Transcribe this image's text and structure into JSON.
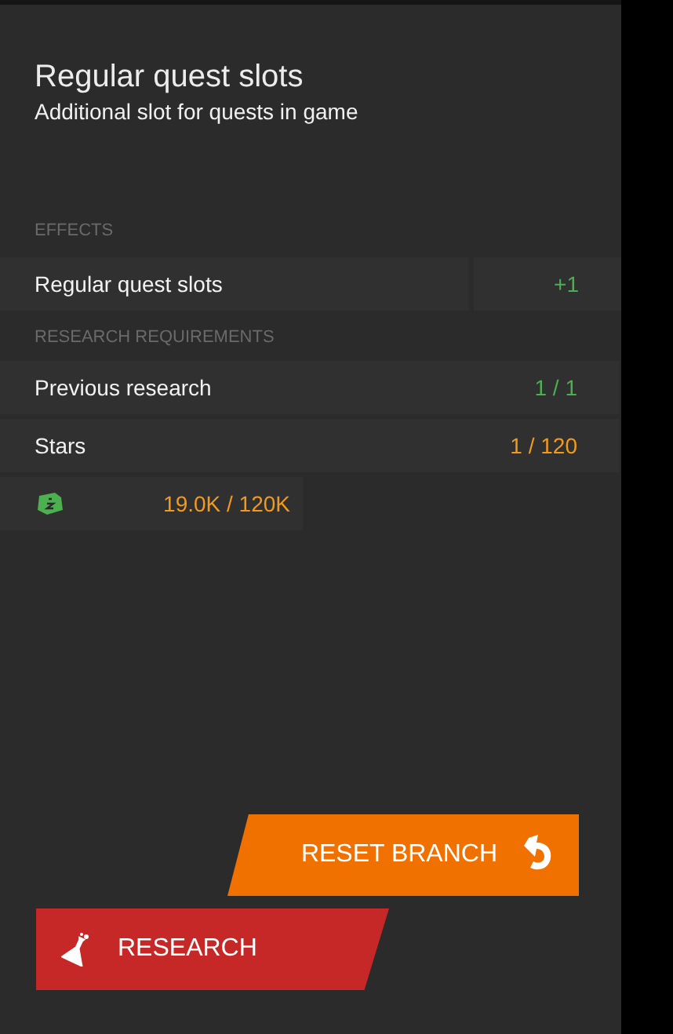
{
  "title": "Regular quest slots",
  "subtitle": "Additional slot for quests in game",
  "effects": {
    "heading": "EFFECTS",
    "rows": [
      {
        "label": "Regular quest slots",
        "value": "+1"
      }
    ]
  },
  "requirements": {
    "heading": "RESEARCH REQUIREMENTS",
    "rows": [
      {
        "kind": "text",
        "label": "Previous research",
        "value": "1 / 1",
        "met": true
      },
      {
        "kind": "text",
        "label": "Stars",
        "value": "1 / 120",
        "met": false
      },
      {
        "kind": "currency",
        "value": "19.0K / 120K",
        "met": false
      }
    ]
  },
  "buttons": [
    {
      "kind": "reset",
      "label": "RESET BRANCH"
    },
    {
      "kind": "research",
      "label": "RESEARCH"
    }
  ]
}
